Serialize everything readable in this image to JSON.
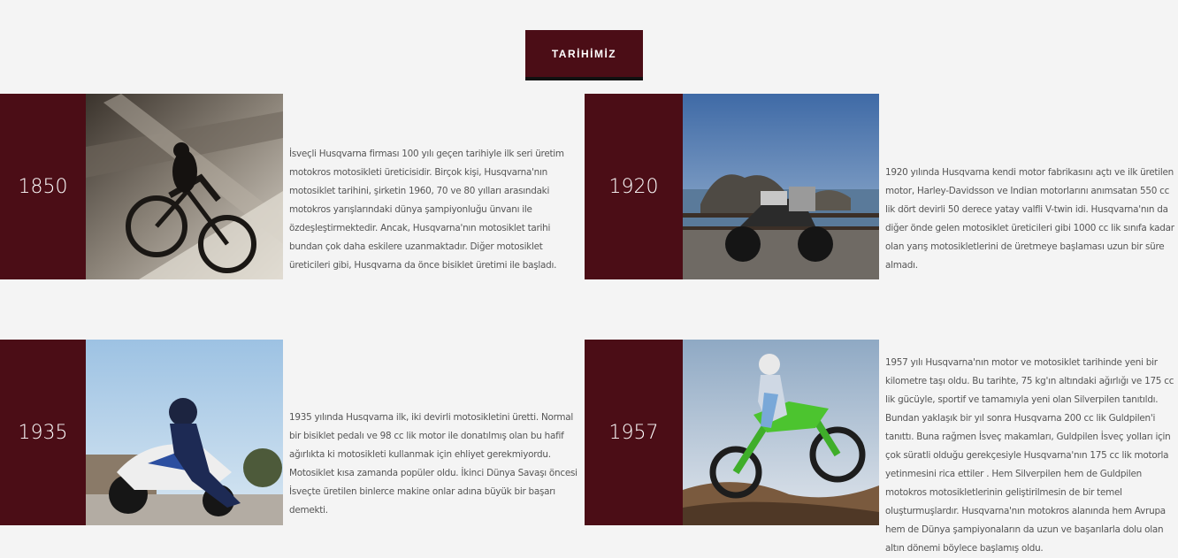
{
  "header": {
    "title": "TARİHİMİZ"
  },
  "timeline": [
    {
      "year": "1850",
      "text": "İsveçli Husqvarna firması 100 yılı geçen tarihiyle ilk seri üretim motokros motosikleti üreticisidir. Birçok kişi, Husqvarna'nın motosiklet tarihini, şirketin 1960, 70 ve 80 yılları arasındaki motokros yarışlarındaki dünya şampiyonluğu ünvanı ile özdeşleştirmektedir. Ancak, Husqvarna'nın motosiklet tarihi bundan çok daha eskilere uzanmaktadır. Diğer motosiklet üreticileri gibi, Husqvarna da önce bisiklet üretimi ile başladı.",
      "image_icon": "vintage-motorcycle-photo"
    },
    {
      "year": "1920",
      "text": "1920 yılında Husqvarna kendi motor fabrikasını açtı ve ilk üretilen motor, Harley-Davidsson ve Indian motorlarını anımsatan 550 cc lik dört devirli 50 derece yatay valfli V-twin idi. Husqvarna'nın da diğer önde gelen motosiklet üreticileri gibi 1000 cc lik sınıfa kadar olan yarış motosikletlerini de üretmeye başlaması uzun bir süre almadı.",
      "image_icon": "adventure-motorcycle-coast-photo"
    },
    {
      "year": "1935",
      "text": "1935 yılında Husqvarna ilk, iki devirli motosikletini üretti. Normal bir bisiklet pedalı ve 98 cc lik motor ile donatılmış olan bu hafif ağırlıkta ki motosikleti kullanmak için ehliyet gerekmiyordu. Motosiklet kısa zamanda popüler oldu. İkinci Dünya Savaşı öncesi İsveçte üretilen binlerce makine onlar adına büyük bir başarı demekti.",
      "image_icon": "sport-motorcycle-rider-photo"
    },
    {
      "year": "1957",
      "text": "1957 yılı Husqvarna'nın motor ve motosiklet tarihinde yeni bir kilometre taşı oldu. Bu tarihte, 75 kg'ın altındaki ağırlığı ve 175 cc lik gücüyle, sportif ve tamamıyla yeni olan Silverpilen tanıtıldı. Bundan yaklaşık bir yıl sonra Husqvarna 200 cc lik Guldpilen'i tanıttı. Buna rağmen İsveç makamları, Guldpilen İsveç yolları için çok süratli olduğu gerekçesiyle Husqvarna'nın 175 cc lik motorla yetinmesini rica ettiler . Hem Silverpilen hem de Guldpilen motokros motosikletlerinin geliştirilmesin de bir temel oluşturmuşlardır. Husqvarna'nın motokros alanında hem Avrupa hem de Dünya şampiyonaların da uzun ve başarılarla dolu olan altın dönemi böylece başlamış oldu.",
      "image_icon": "motocross-jump-photo"
    }
  ]
}
